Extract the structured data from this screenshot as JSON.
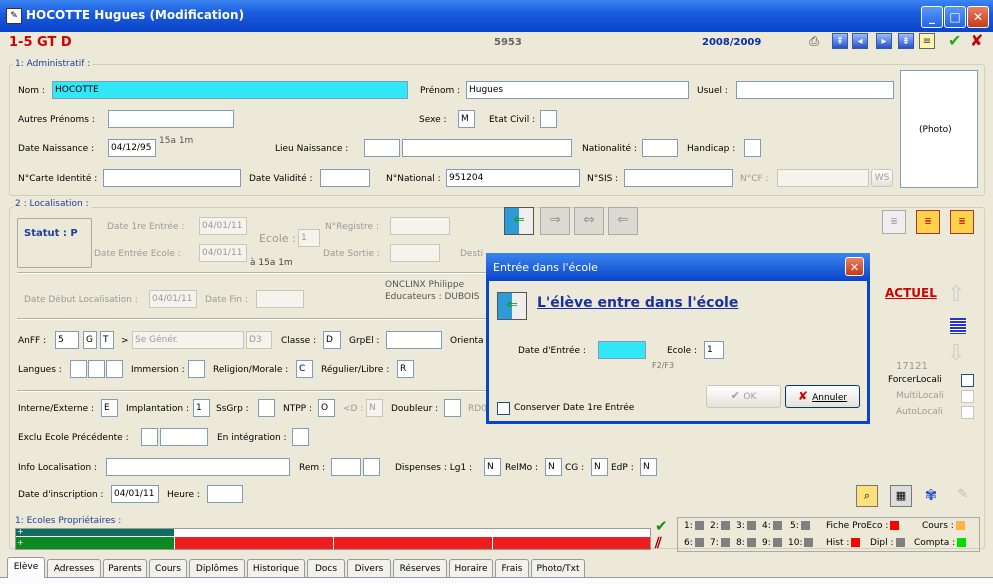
{
  "window": {
    "title": "HOCOTTE Hugues (Modification)",
    "app_icon": "form-icon",
    "minimize": "_",
    "maximize": "□",
    "close": "✕"
  },
  "header": {
    "class_code": "1-5 GT D",
    "number": "5953",
    "year": "2008/2009",
    "nav_icons": [
      "first-icon",
      "prev-icon",
      "next-icon",
      "last-icon"
    ],
    "validate": "✔",
    "cancel": "✘"
  },
  "admin": {
    "section_title": "1: Administratif :",
    "nom_label": "Nom :",
    "nom_value": "HOCOTTE",
    "prenom_label": "Prénom :",
    "prenom_value": "Hugues",
    "usuel_label": "Usuel :",
    "usuel_value": "",
    "autres_prenoms_label": "Autres Prénoms :",
    "sexe_label": "Sexe :",
    "sexe_value": "M",
    "etat_civil_label": "Etat Civil :",
    "photo_label": "(Photo)",
    "date_naissance_label": "Date Naissance :",
    "date_naissance_value": "04/12/95",
    "age": "15a 1m",
    "lieu_naissance_label": "Lieu Naissance :",
    "nationalite_label": "Nationalité :",
    "handicap_label": "Handicap :",
    "carte_identite_label": "N°Carte Identité :",
    "date_validite_label": "Date Validité :",
    "national_label": "N°National :",
    "national_value": "951204",
    "sis_label": "N°SIS :",
    "cf_label": "N°CF :",
    "ws_button": "WS"
  },
  "localisation": {
    "section_title": "2 : Localisation :",
    "statut": "Statut : P",
    "date_1re_entree_label": "Date 1re Entrée :",
    "date_1re_entree_value": "04/01/11",
    "ecole_label": "Ecole :",
    "ecole_value": "1",
    "registre_label": "N°Registre :",
    "date_entree_ecole_label": "Date Entrée Ecole :",
    "date_entree_ecole_value": "04/01/11",
    "age_entree": "à 15a 1m",
    "date_sortie_label": "Date Sortie :",
    "destination_label": "Desti",
    "onclinx": "ONCLINX Philippe",
    "educateurs": "Educateurs : DUBOIS",
    "date_debut_label": "Date Début Localisation :",
    "date_debut_value": "04/01/11",
    "date_fin_label": "Date Fin :",
    "actuel": "ACTUEL",
    "count": "17121",
    "forcer_label": "ForcerLocali",
    "multi_label": "MultiLocali",
    "auto_label": "AutoLocali"
  },
  "classe": {
    "anff_label": "AnFF :",
    "anff_1": "5",
    "anff_2": "G",
    "anff_3": "T",
    "anff_arrow": ">",
    "anff_gen": "Se Génér.",
    "anff_d3": "D3",
    "classe_label": "Classe :",
    "classe_value": "D",
    "grpel_label": "GrpEl :",
    "orienta_label": "Orienta",
    "langues_label": "Langues :",
    "immersion_label": "Immersion :",
    "religion_label": "Religion/Morale :",
    "religion_value": "C",
    "regulier_label": "Régulier/Libre :",
    "regulier_value": "R"
  },
  "regime": {
    "interne_label": "Interne/Externe :",
    "interne_value": "E",
    "implantation_label": "Implantation :",
    "implantation_value": "1",
    "ssgrp_label": "SsGrp :",
    "ntpp_label": "NTPP :",
    "ntpp_value": "O",
    "lt_d_label": "<D :",
    "lt_d_value": "N",
    "doubleur_label": "Doubleur :",
    "rdd_label": "RD0",
    "exclu_label": "Exclu Ecole Précédente :",
    "integration_label": "En intégration :",
    "info_loc_label": "Info Localisation :",
    "rem_label": "Rem :",
    "dispenses_label": "Dispenses : Lg1 :",
    "lg1_value": "N",
    "relmo_label": "RelMo :",
    "relmo_value": "N",
    "cg_label": "CG :",
    "cg_value": "N",
    "edp_label": "EdP :",
    "edp_value": "N",
    "inscription_label": "Date d'inscription :",
    "inscription_value": "04/01/11",
    "heure_label": "Heure :"
  },
  "proprietaires": {
    "title": "1: Ecoles Propriétaires :",
    "plus_1": "+",
    "plus_2": "+"
  },
  "legend": {
    "items": [
      {
        "label": "1:",
        "color": "#808080"
      },
      {
        "label": "2:",
        "color": "#808080"
      },
      {
        "label": "3:",
        "color": "#808080"
      },
      {
        "label": "4:",
        "color": "#808080"
      },
      {
        "label": "5:",
        "color": "#808080"
      },
      {
        "label": "6:",
        "color": "#808080"
      },
      {
        "label": "7:",
        "color": "#808080"
      },
      {
        "label": "8:",
        "color": "#808080"
      },
      {
        "label": "9:",
        "color": "#808080"
      },
      {
        "label": "10:",
        "color": "#808080"
      }
    ],
    "fiche_proeco": "Fiche ProEco :",
    "fiche_color": "#ff0000",
    "cours": "Cours :",
    "cours_color": "#ffb347",
    "hist": "Hist :",
    "hist_color": "#ff0000",
    "dipl": "Dipl :",
    "dipl_color": "#808080",
    "compta": "Compta :",
    "compta_color": "#00dd00"
  },
  "dialog": {
    "title": "Entrée dans l'école",
    "heading": "L'élève entre dans l'école",
    "date_entree_label": "Date d'Entrée :",
    "date_entree_value": "",
    "ecole_label": "Ecole :",
    "ecole_value": "1",
    "f2f3": "F2/F3",
    "conserver_label": "Conserver Date 1re Entrée",
    "ok_label": "OK",
    "annuler_label": "Annuler"
  },
  "tabs": [
    "Elève",
    "Adresses",
    "Parents",
    "Cours",
    "Diplômes",
    "Historique",
    "Docs",
    "Divers",
    "Réserves",
    "Horaire",
    "Frais",
    "Photo/Txt"
  ]
}
